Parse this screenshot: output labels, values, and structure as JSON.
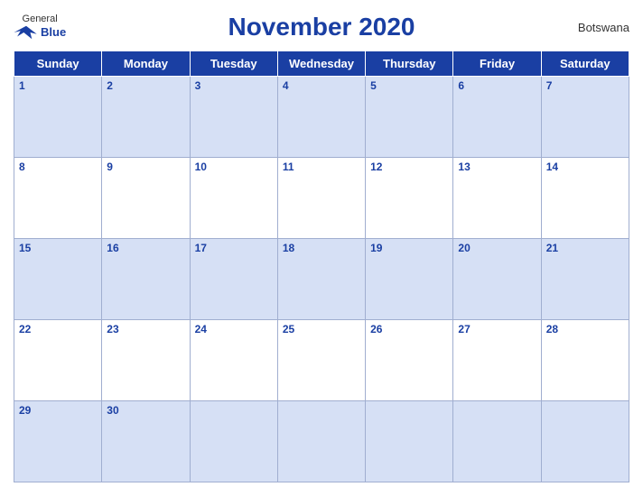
{
  "header": {
    "logo_general": "General",
    "logo_blue": "Blue",
    "title": "November 2020",
    "country": "Botswana"
  },
  "weekdays": [
    "Sunday",
    "Monday",
    "Tuesday",
    "Wednesday",
    "Thursday",
    "Friday",
    "Saturday"
  ],
  "weeks": [
    [
      {
        "day": 1,
        "empty": false
      },
      {
        "day": 2,
        "empty": false
      },
      {
        "day": 3,
        "empty": false
      },
      {
        "day": 4,
        "empty": false
      },
      {
        "day": 5,
        "empty": false
      },
      {
        "day": 6,
        "empty": false
      },
      {
        "day": 7,
        "empty": false
      }
    ],
    [
      {
        "day": 8,
        "empty": false
      },
      {
        "day": 9,
        "empty": false
      },
      {
        "day": 10,
        "empty": false
      },
      {
        "day": 11,
        "empty": false
      },
      {
        "day": 12,
        "empty": false
      },
      {
        "day": 13,
        "empty": false
      },
      {
        "day": 14,
        "empty": false
      }
    ],
    [
      {
        "day": 15,
        "empty": false
      },
      {
        "day": 16,
        "empty": false
      },
      {
        "day": 17,
        "empty": false
      },
      {
        "day": 18,
        "empty": false
      },
      {
        "day": 19,
        "empty": false
      },
      {
        "day": 20,
        "empty": false
      },
      {
        "day": 21,
        "empty": false
      }
    ],
    [
      {
        "day": 22,
        "empty": false
      },
      {
        "day": 23,
        "empty": false
      },
      {
        "day": 24,
        "empty": false
      },
      {
        "day": 25,
        "empty": false
      },
      {
        "day": 26,
        "empty": false
      },
      {
        "day": 27,
        "empty": false
      },
      {
        "day": 28,
        "empty": false
      }
    ],
    [
      {
        "day": 29,
        "empty": false
      },
      {
        "day": 30,
        "empty": false
      },
      {
        "day": null,
        "empty": true
      },
      {
        "day": null,
        "empty": true
      },
      {
        "day": null,
        "empty": true
      },
      {
        "day": null,
        "empty": true
      },
      {
        "day": null,
        "empty": true
      }
    ]
  ],
  "colors": {
    "blue": "#1a3fa3",
    "light_blue_row": "#d6e0f5",
    "white": "#ffffff"
  }
}
